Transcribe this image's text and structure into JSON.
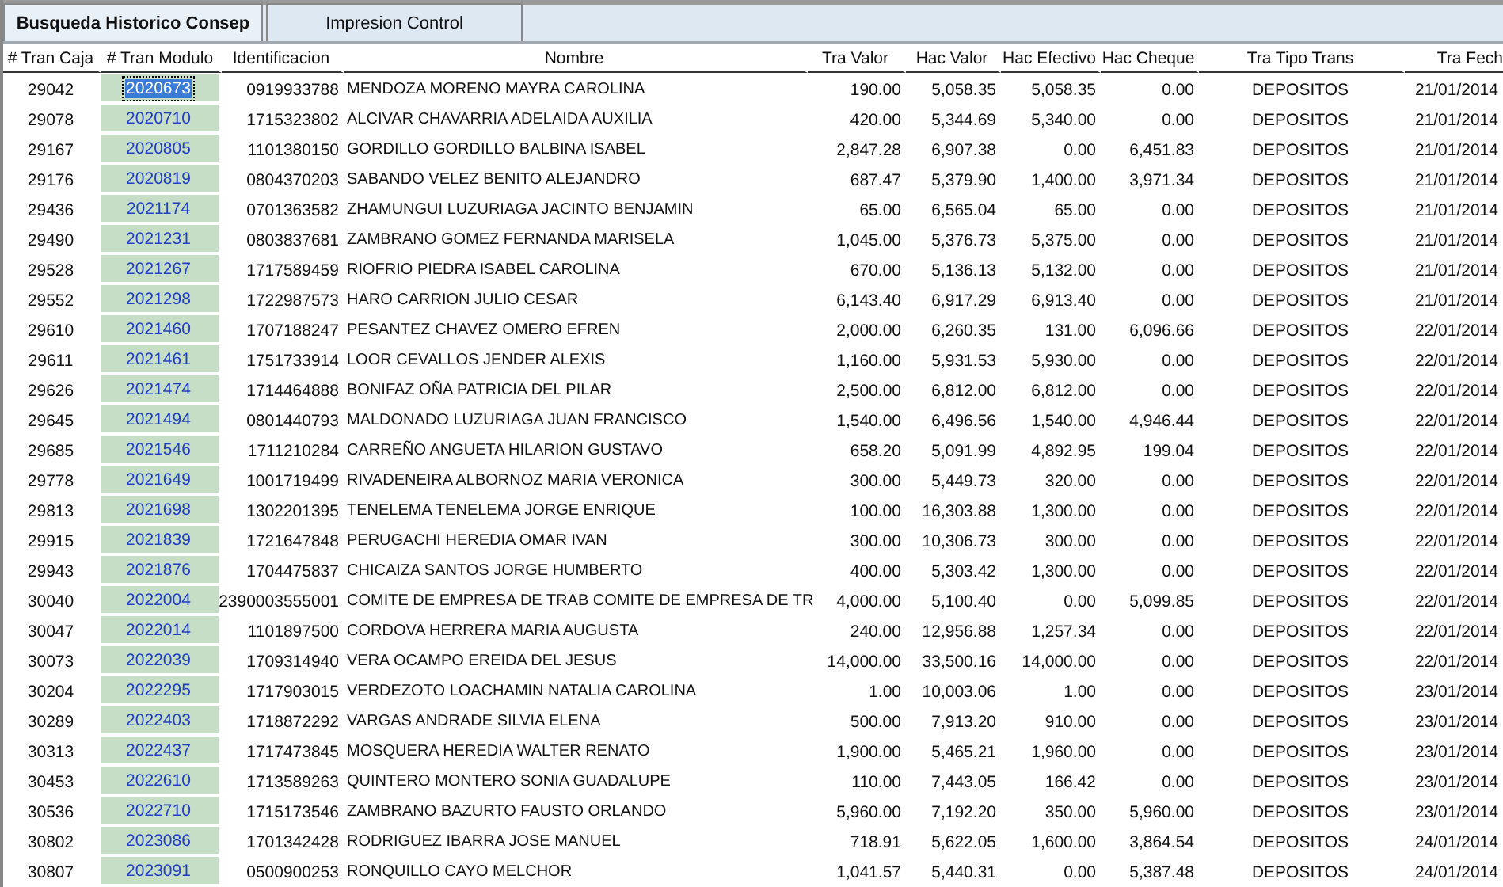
{
  "tabs": [
    {
      "label": "Busqueda Historico Consep",
      "selected": true
    },
    {
      "label": "Impresion Control",
      "selected": false
    }
  ],
  "table": {
    "columns": [
      "# Tran Caja",
      "# Tran Modulo",
      "Identificacion",
      "Nombre",
      "Tra Valor",
      "Hac Valor",
      "Hac Efectivo",
      "Hac Cheque",
      "Tra Tipo Trans",
      "Tra Fech"
    ],
    "rows": [
      {
        "selected": true,
        "cells": [
          "29042",
          "2020673",
          "0919933788",
          "MENDOZA MORENO MAYRA CAROLINA",
          "190.00",
          "5,058.35",
          "5,058.35",
          "0.00",
          "DEPOSITOS",
          "21/01/2014"
        ]
      },
      {
        "selected": false,
        "cells": [
          "29078",
          "2020710",
          "1715323802",
          "ALCIVAR CHAVARRIA ADELAIDA AUXILIA",
          "420.00",
          "5,344.69",
          "5,340.00",
          "0.00",
          "DEPOSITOS",
          "21/01/2014"
        ]
      },
      {
        "selected": false,
        "cells": [
          "29167",
          "2020805",
          "1101380150",
          "GORDILLO GORDILLO BALBINA ISABEL",
          "2,847.28",
          "6,907.38",
          "0.00",
          "6,451.83",
          "DEPOSITOS",
          "21/01/2014"
        ]
      },
      {
        "selected": false,
        "cells": [
          "29176",
          "2020819",
          "0804370203",
          "SABANDO VELEZ BENITO ALEJANDRO",
          "687.47",
          "5,379.90",
          "1,400.00",
          "3,971.34",
          "DEPOSITOS",
          "21/01/2014"
        ]
      },
      {
        "selected": false,
        "cells": [
          "29436",
          "2021174",
          "0701363582",
          "ZHAMUNGUI LUZURIAGA JACINTO BENJAMIN",
          "65.00",
          "6,565.04",
          "65.00",
          "0.00",
          "DEPOSITOS",
          "21/01/2014"
        ]
      },
      {
        "selected": false,
        "cells": [
          "29490",
          "2021231",
          "0803837681",
          "ZAMBRANO GOMEZ FERNANDA MARISELA",
          "1,045.00",
          "5,376.73",
          "5,375.00",
          "0.00",
          "DEPOSITOS",
          "21/01/2014"
        ]
      },
      {
        "selected": false,
        "cells": [
          "29528",
          "2021267",
          "1717589459",
          "RIOFRIO PIEDRA ISABEL CAROLINA",
          "670.00",
          "5,136.13",
          "5,132.00",
          "0.00",
          "DEPOSITOS",
          "21/01/2014"
        ]
      },
      {
        "selected": false,
        "cells": [
          "29552",
          "2021298",
          "1722987573",
          "HARO CARRION JULIO CESAR",
          "6,143.40",
          "6,917.29",
          "6,913.40",
          "0.00",
          "DEPOSITOS",
          "21/01/2014"
        ]
      },
      {
        "selected": false,
        "cells": [
          "29610",
          "2021460",
          "1707188247",
          "PESANTEZ CHAVEZ OMERO EFREN",
          "2,000.00",
          "6,260.35",
          "131.00",
          "6,096.66",
          "DEPOSITOS",
          "22/01/2014"
        ]
      },
      {
        "selected": false,
        "cells": [
          "29611",
          "2021461",
          "1751733914",
          "LOOR CEVALLOS JENDER ALEXIS",
          "1,160.00",
          "5,931.53",
          "5,930.00",
          "0.00",
          "DEPOSITOS",
          "22/01/2014"
        ]
      },
      {
        "selected": false,
        "cells": [
          "29626",
          "2021474",
          "1714464888",
          "BONIFAZ OÑA PATRICIA DEL PILAR",
          "2,500.00",
          "6,812.00",
          "6,812.00",
          "0.00",
          "DEPOSITOS",
          "22/01/2014"
        ]
      },
      {
        "selected": false,
        "cells": [
          "29645",
          "2021494",
          "0801440793",
          "MALDONADO LUZURIAGA JUAN FRANCISCO",
          "1,540.00",
          "6,496.56",
          "1,540.00",
          "4,946.44",
          "DEPOSITOS",
          "22/01/2014"
        ]
      },
      {
        "selected": false,
        "cells": [
          "29685",
          "2021546",
          "1711210284",
          "CARREÑO ANGUETA HILARION GUSTAVO",
          "658.20",
          "5,091.99",
          "4,892.95",
          "199.04",
          "DEPOSITOS",
          "22/01/2014"
        ]
      },
      {
        "selected": false,
        "cells": [
          "29778",
          "2021649",
          "1001719499",
          "RIVADENEIRA ALBORNOZ MARIA VERONICA",
          "300.00",
          "5,449.73",
          "320.00",
          "0.00",
          "DEPOSITOS",
          "22/01/2014"
        ]
      },
      {
        "selected": false,
        "cells": [
          "29813",
          "2021698",
          "1302201395",
          "TENELEMA TENELEMA JORGE ENRIQUE",
          "100.00",
          "16,303.88",
          "1,300.00",
          "0.00",
          "DEPOSITOS",
          "22/01/2014"
        ]
      },
      {
        "selected": false,
        "cells": [
          "29915",
          "2021839",
          "1721647848",
          "PERUGACHI HEREDIA OMAR IVAN",
          "300.00",
          "10,306.73",
          "300.00",
          "0.00",
          "DEPOSITOS",
          "22/01/2014"
        ]
      },
      {
        "selected": false,
        "cells": [
          "29943",
          "2021876",
          "1704475837",
          "CHICAIZA SANTOS JORGE HUMBERTO",
          "400.00",
          "5,303.42",
          "1,300.00",
          "0.00",
          "DEPOSITOS",
          "22/01/2014"
        ]
      },
      {
        "selected": false,
        "cells": [
          "30040",
          "2022004",
          "2390003555001",
          "COMITE DE EMPRESA DE TRAB COMITE DE EMPRESA DE TR",
          "4,000.00",
          "5,100.40",
          "0.00",
          "5,099.85",
          "DEPOSITOS",
          "22/01/2014"
        ]
      },
      {
        "selected": false,
        "cells": [
          "30047",
          "2022014",
          "1101897500",
          "CORDOVA HERRERA MARIA AUGUSTA",
          "240.00",
          "12,956.88",
          "1,257.34",
          "0.00",
          "DEPOSITOS",
          "22/01/2014"
        ]
      },
      {
        "selected": false,
        "cells": [
          "30073",
          "2022039",
          "1709314940",
          "VERA OCAMPO EREIDA DEL JESUS",
          "14,000.00",
          "33,500.16",
          "14,000.00",
          "0.00",
          "DEPOSITOS",
          "22/01/2014"
        ]
      },
      {
        "selected": false,
        "cells": [
          "30204",
          "2022295",
          "1717903015",
          "VERDEZOTO LOACHAMIN NATALIA CAROLINA",
          "1.00",
          "10,003.06",
          "1.00",
          "0.00",
          "DEPOSITOS",
          "23/01/2014"
        ]
      },
      {
        "selected": false,
        "cells": [
          "30289",
          "2022403",
          "1718872292",
          "VARGAS ANDRADE SILVIA ELENA",
          "500.00",
          "7,913.20",
          "910.00",
          "0.00",
          "DEPOSITOS",
          "23/01/2014"
        ]
      },
      {
        "selected": false,
        "cells": [
          "30313",
          "2022437",
          "1717473845",
          "MOSQUERA HEREDIA WALTER RENATO",
          "1,900.00",
          "5,465.21",
          "1,960.00",
          "0.00",
          "DEPOSITOS",
          "23/01/2014"
        ]
      },
      {
        "selected": false,
        "cells": [
          "30453",
          "2022610",
          "1713589263",
          "QUINTERO MONTERO SONIA GUADALUPE",
          "110.00",
          "7,443.05",
          "166.42",
          "0.00",
          "DEPOSITOS",
          "23/01/2014"
        ]
      },
      {
        "selected": false,
        "cells": [
          "30536",
          "2022710",
          "1715173546",
          "ZAMBRANO BAZURTO FAUSTO ORLANDO",
          "5,960.00",
          "7,192.20",
          "350.00",
          "5,960.00",
          "DEPOSITOS",
          "23/01/2014"
        ]
      },
      {
        "selected": false,
        "cells": [
          "30802",
          "2023086",
          "1701342428",
          "RODRIGUEZ IBARRA JOSE MANUEL",
          "718.91",
          "5,622.05",
          "1,600.00",
          "3,864.54",
          "DEPOSITOS",
          "24/01/2014"
        ]
      },
      {
        "selected": false,
        "cells": [
          "30807",
          "2023091",
          "0500900253",
          "RONQUILLO CAYO MELCHOR",
          "1,041.57",
          "5,440.31",
          "0.00",
          "5,387.48",
          "DEPOSITOS",
          "24/01/2014"
        ]
      }
    ]
  }
}
